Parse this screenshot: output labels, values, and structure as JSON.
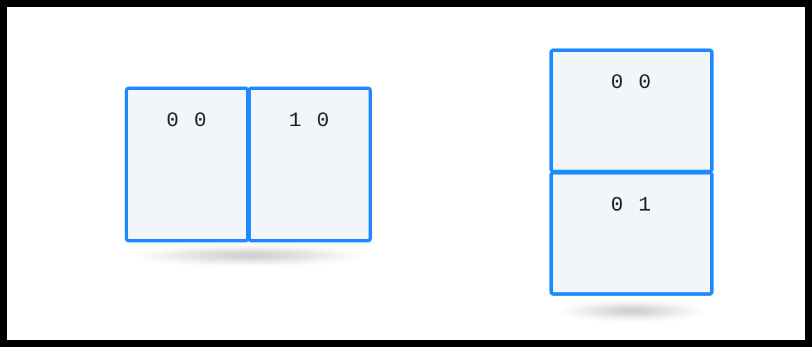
{
  "groups": {
    "horizontal": {
      "orientation": "row",
      "boxes": [
        {
          "label": "0 0"
        },
        {
          "label": "1 0"
        }
      ]
    },
    "vertical": {
      "orientation": "column",
      "boxes": [
        {
          "label": "0 0"
        },
        {
          "label": "0 1"
        }
      ]
    }
  },
  "style": {
    "border_color": "#1e88ff",
    "fill_color": "#f3f6f9"
  }
}
